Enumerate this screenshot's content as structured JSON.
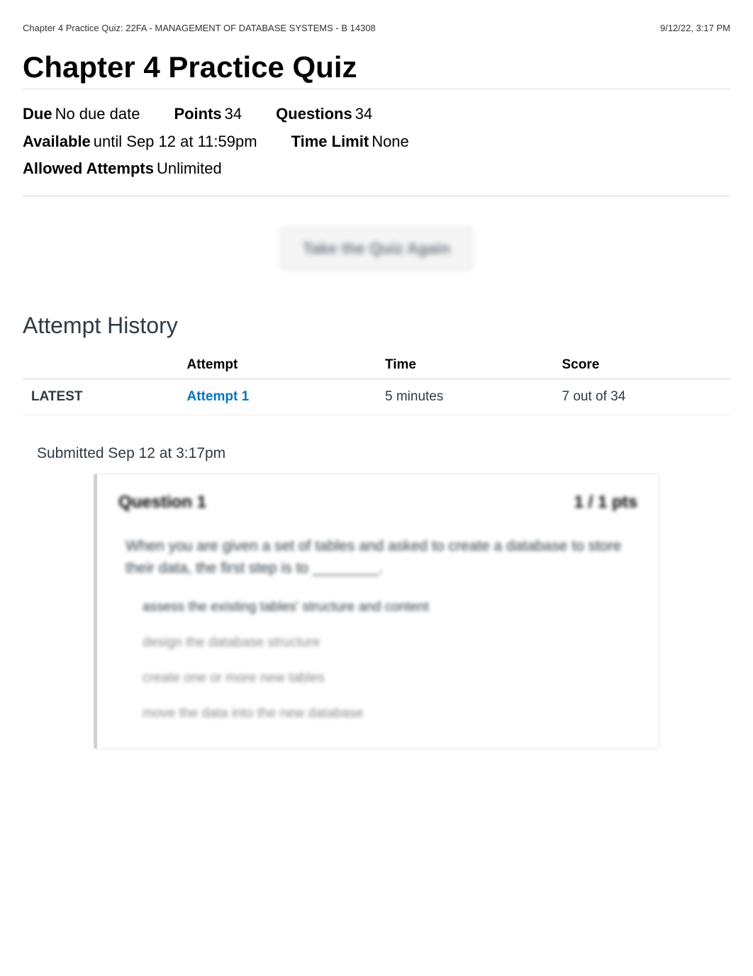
{
  "header": {
    "left": "Chapter 4 Practice Quiz: 22FA - MANAGEMENT OF DATABASE SYSTEMS - B 14308",
    "right": "9/12/22, 3:17 PM"
  },
  "title": "Chapter 4 Practice Quiz",
  "details": {
    "due": {
      "label": "Due",
      "value": "No due date"
    },
    "points": {
      "label": "Points",
      "value": "34"
    },
    "questions": {
      "label": "Questions",
      "value": "34"
    },
    "available": {
      "label": "Available",
      "value": "until Sep 12 at 11:59pm"
    },
    "time_limit": {
      "label": "Time Limit",
      "value": "None"
    },
    "allowed_attempts": {
      "label": "Allowed Attempts",
      "value": "Unlimited"
    }
  },
  "take_again_label": "Take the Quiz Again",
  "attempt_history": {
    "heading": "Attempt History",
    "columns": {
      "blank": "",
      "attempt": "Attempt",
      "time": "Time",
      "score": "Score"
    },
    "rows": [
      {
        "badge": "LATEST",
        "attempt": "Attempt 1",
        "time": "5 minutes",
        "score": "7 out of 34"
      }
    ]
  },
  "submitted_text": "Submitted Sep 12 at 3:17pm",
  "question": {
    "title": "Question 1",
    "points": "1 / 1 pts",
    "prompt": "When you are given a set of tables and asked to create a database to store their data, the first step is to ________.",
    "options": [
      {
        "text": "assess the existing tables' structure and content",
        "selected": true
      },
      {
        "text": "design the database structure",
        "selected": false
      },
      {
        "text": "create one or more new tables",
        "selected": false
      },
      {
        "text": "move the data into the new database",
        "selected": false
      }
    ]
  }
}
